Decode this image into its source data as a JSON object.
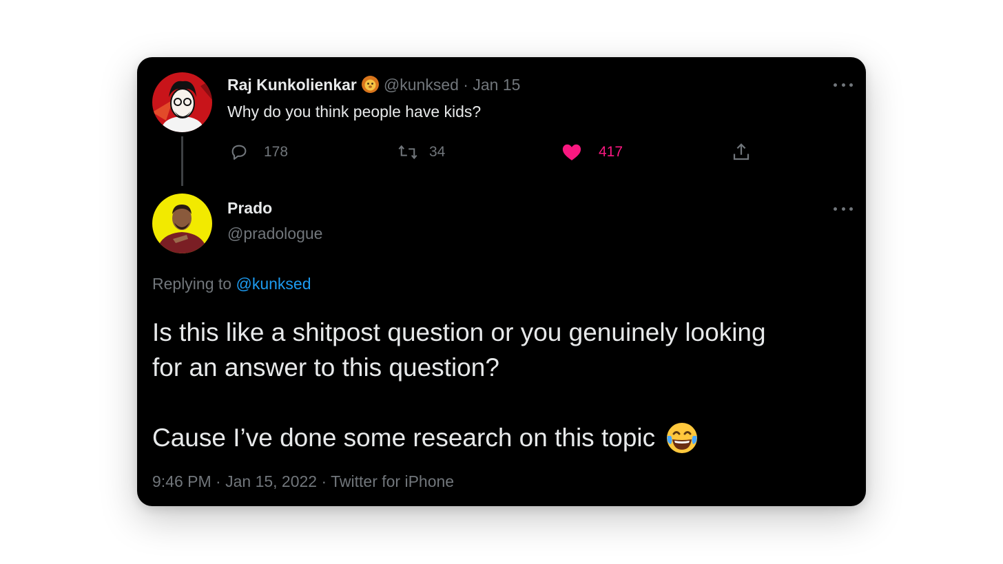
{
  "parent_tweet": {
    "display_name": "Raj Kunkolienkar",
    "badge_icon": "lion-emoji-icon",
    "handle": "@kunksed",
    "separator": "·",
    "date": "Jan 15",
    "text": "Why do you think people have kids?",
    "actions": {
      "reply_count": "178",
      "retweet_count": "34",
      "like_count": "417",
      "liked": true
    }
  },
  "reply_tweet": {
    "display_name": "Prado",
    "handle": "@pradologue",
    "replying_prefix": "Replying to",
    "replying_to": "@kunksed",
    "text_line1": "Is this like a shitpost question or you genuinely looking",
    "text_line2": "for an answer to this question?",
    "text_line3": "Cause I’ve done some research on this topic",
    "trailing_emoji_icon": "laughing-tears-emoji-icon",
    "timestamp": "9:46 PM · Jan 15, 2022 · Twitter for iPhone"
  },
  "colors": {
    "background": "#000000",
    "text": "#e7e9ea",
    "muted": "#71767b",
    "link": "#1d9bf0",
    "like": "#f91880"
  }
}
